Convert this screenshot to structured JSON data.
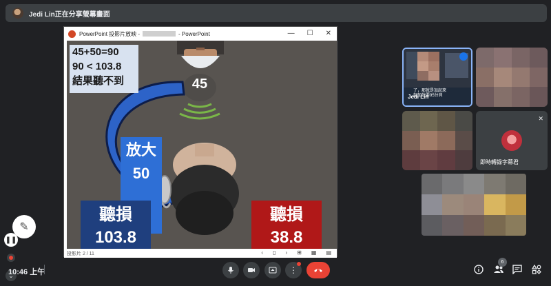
{
  "banner": {
    "text": "Jedi Lin正在分享螢幕畫面"
  },
  "ppt": {
    "title_prefix": "PowerPoint 投影片放映  -",
    "title_suffix": "- PowerPoint",
    "window_controls": [
      "—",
      "☐",
      "✕"
    ],
    "status_left": "投影片 2 / 11",
    "status_ctrls": [
      "‹",
      "▯",
      "›",
      "⊞",
      "▦",
      "▤"
    ]
  },
  "slide": {
    "formula_lines": [
      "45+50=90",
      "90 < 103.8",
      "結果聽不到"
    ],
    "sound_db": "45",
    "amp_label": "放大",
    "amp_value": "50",
    "loss_left_label": "聽損",
    "loss_left_value": "103.8",
    "loss_right_label": "聽損",
    "loss_right_value": "38.8"
  },
  "tiles": {
    "speaker_name": "Jedi Lin",
    "speaker_caption": "了，那就是加起來\n起加說要95分貝",
    "caption_bot_name": "即時轉錄字幕君"
  },
  "bottom": {
    "clock": "10:46 上午",
    "participants_count": "6"
  },
  "icons": {
    "mic": "mic-icon",
    "camera": "camera-icon",
    "present": "present-icon",
    "more": "more-icon",
    "end": "end-call-icon",
    "info": "info-icon",
    "people": "people-icon",
    "chat": "chat-icon",
    "activities": "activities-icon"
  },
  "colors": {
    "amp_blue": "#2e6fd6",
    "loss_navy": "#1f3f7e",
    "loss_red": "#b01818",
    "end_call": "#ea4335"
  }
}
